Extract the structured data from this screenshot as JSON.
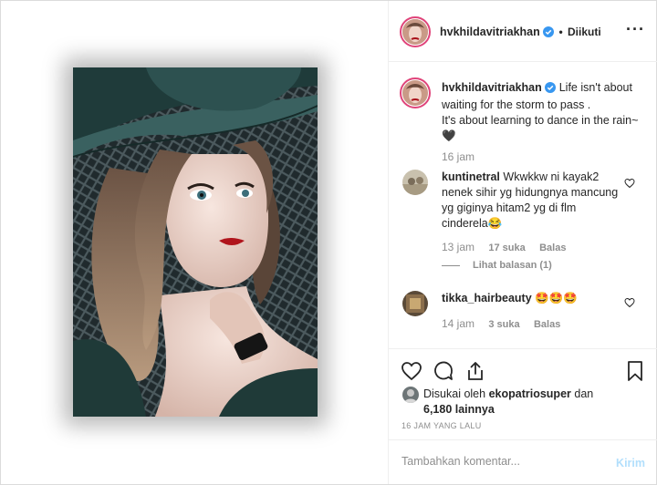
{
  "author": {
    "username": "hvkhildavitriakhan",
    "follow_status": "Diikuti"
  },
  "caption": {
    "username": "hvkhildavitriakhan",
    "line1": "Life isn't about waiting for the storm to pass .",
    "line2": "It's about learning to dance in the rain~",
    "emoji": "🖤",
    "age": "16 jam"
  },
  "comments": [
    {
      "username": "kuntinetral",
      "text": "Wkwkkw ni kayak2 nenek sihir yg hidungnya mancung yg giginya hitam2 yg di flm cinderela",
      "emoji": "😂",
      "age": "13 jam",
      "likes": "17 suka",
      "reply_label": "Balas",
      "view_replies": "Lihat balasan (1)"
    },
    {
      "username": "tikka_hairbeauty",
      "text": "",
      "emoji": "🤩🤩🤩",
      "age": "14 jam",
      "likes": "3 suka",
      "reply_label": "Balas"
    }
  ],
  "likes": {
    "prefix": "Disukai oleh",
    "liker": "ekopatriosuper",
    "joiner": "dan",
    "others": "6,180 lainnya"
  },
  "timestamp": "16 JAM YANG LALU",
  "add_comment": {
    "placeholder": "Tambahkan komentar...",
    "post_label": "Kirim"
  },
  "colors": {
    "verified": "#3897f0",
    "post_disabled": "#b2dffc",
    "muted": "#8e8e8e",
    "text": "#262626",
    "story_ring": "#e0447a"
  },
  "icons": [
    "more-options-icon",
    "verified-badge-icon",
    "like-icon",
    "comment-icon",
    "share-icon",
    "save-icon",
    "comment-like-icon"
  ]
}
